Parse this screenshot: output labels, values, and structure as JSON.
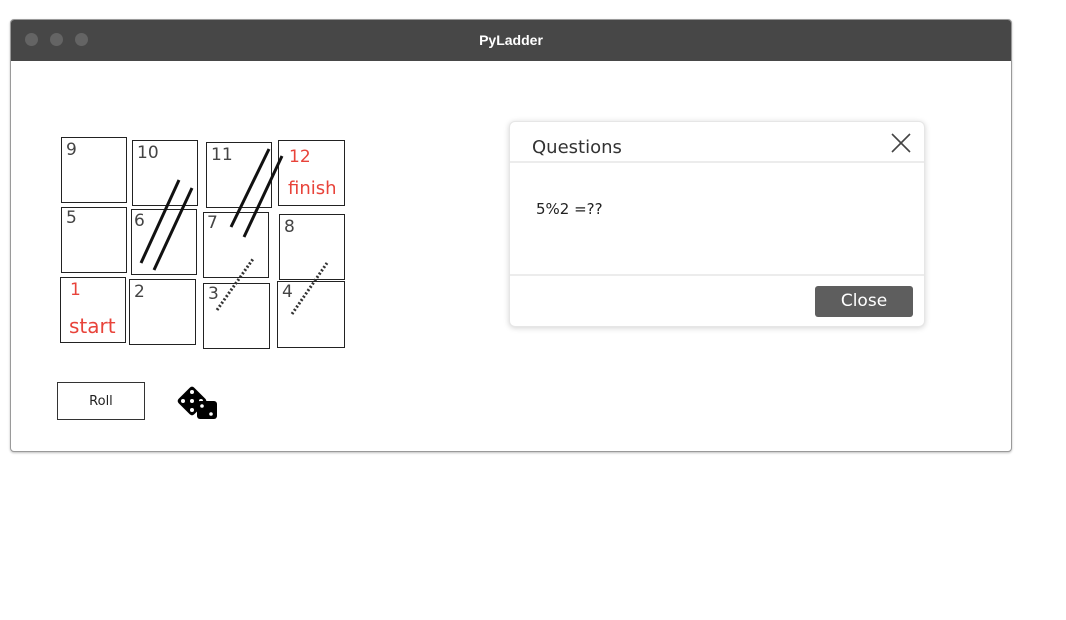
{
  "window": {
    "title": "PyLadder"
  },
  "board": {
    "cells": [
      {
        "number": "9"
      },
      {
        "number": "10"
      },
      {
        "number": "11"
      },
      {
        "number": "12",
        "label": "finish"
      },
      {
        "number": "5"
      },
      {
        "number": "6"
      },
      {
        "number": "7"
      },
      {
        "number": "8"
      },
      {
        "number": "1",
        "label": "start"
      },
      {
        "number": "2"
      },
      {
        "number": "3"
      },
      {
        "number": "4"
      }
    ],
    "highlight_color": "#e8433a"
  },
  "controls": {
    "roll_label": "Roll",
    "dice_icon": "dice-icon"
  },
  "dialog": {
    "title": "Questions",
    "question": "5%2 =??",
    "close_label": "Close",
    "close_icon": "close-icon"
  }
}
